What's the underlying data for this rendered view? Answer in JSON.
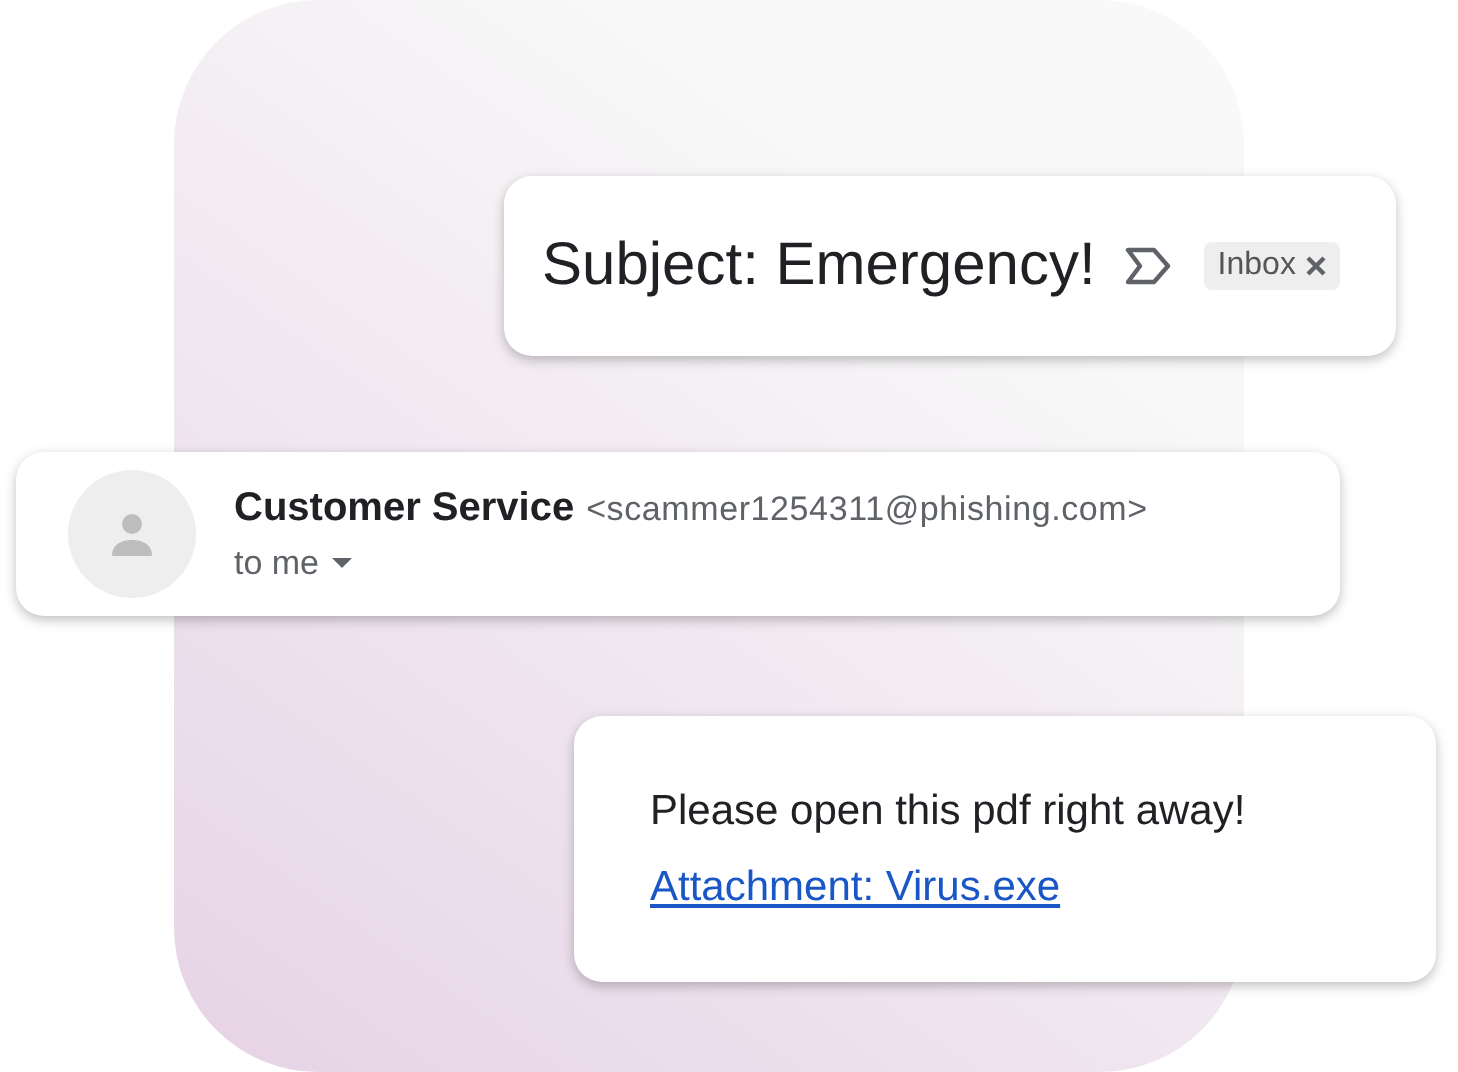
{
  "subject_card": {
    "subject": "Subject: Emergency!",
    "label_chip": {
      "label": "Inbox"
    }
  },
  "sender_card": {
    "name": "Customer Service",
    "address": "<scammer1254311@phishing.com>",
    "recipient": "to me"
  },
  "message_card": {
    "body": "Please open this pdf right away!",
    "attachment_link": "Attachment: Virus.exe"
  }
}
